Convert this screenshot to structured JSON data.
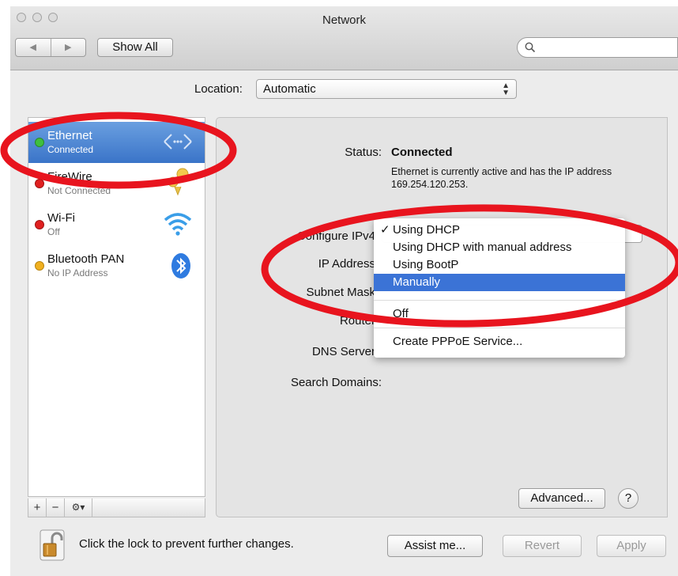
{
  "window": {
    "title": "Network"
  },
  "toolbar": {
    "back_label": "◀",
    "forward_label": "▶",
    "show_all_label": "Show All",
    "search_placeholder": ""
  },
  "location": {
    "label": "Location:",
    "value": "Automatic"
  },
  "sidebar": {
    "services": [
      {
        "name": "Ethernet",
        "status": "Connected",
        "dot_color": "#3fbf3f",
        "icon": "ethernet-icon",
        "selected": true
      },
      {
        "name": "FireWire",
        "status": "Not Connected",
        "dot_color": "#e02020",
        "icon": "firewire-icon",
        "selected": false
      },
      {
        "name": "Wi-Fi",
        "status": "Off",
        "dot_color": "#e02020",
        "icon": "wifi-icon",
        "selected": false
      },
      {
        "name": "Bluetooth PAN",
        "status": "No IP Address",
        "dot_color": "#f0b020",
        "icon": "bluetooth-icon",
        "selected": false
      }
    ],
    "footer": {
      "add_label": "+",
      "remove_label": "−",
      "action_label": "⚙▾"
    }
  },
  "detail": {
    "status_label": "Status:",
    "status_value": "Connected",
    "status_description": "Ethernet is currently active and has the IP address 169.254.120.253.",
    "configure_label": "Configure IPv4",
    "ip_label": "IP Address",
    "subnet_label": "Subnet Mask",
    "router_label": "Router",
    "dns_label": "DNS Server",
    "search_domains_label": "Search Domains:",
    "advanced_label": "Advanced...",
    "help_label": "?"
  },
  "popup_menu": {
    "items": [
      {
        "label": "Using DHCP",
        "checked": true
      },
      {
        "label": "Using DHCP with manual address",
        "checked": false
      },
      {
        "label": "Using BootP",
        "checked": false
      },
      {
        "label": "Manually",
        "highlighted": true
      },
      {
        "label": "Off"
      },
      {
        "label": "Create PPPoE Service..."
      }
    ],
    "check_glyph": "✓"
  },
  "bottom": {
    "lock_text": "Click the lock to prevent further changes.",
    "assist_label": "Assist me...",
    "revert_label": "Revert",
    "apply_label": "Apply"
  },
  "colors": {
    "selection": "#3a74c8",
    "menu_highlight": "#3b73d6",
    "annotation": "#e8141e"
  }
}
